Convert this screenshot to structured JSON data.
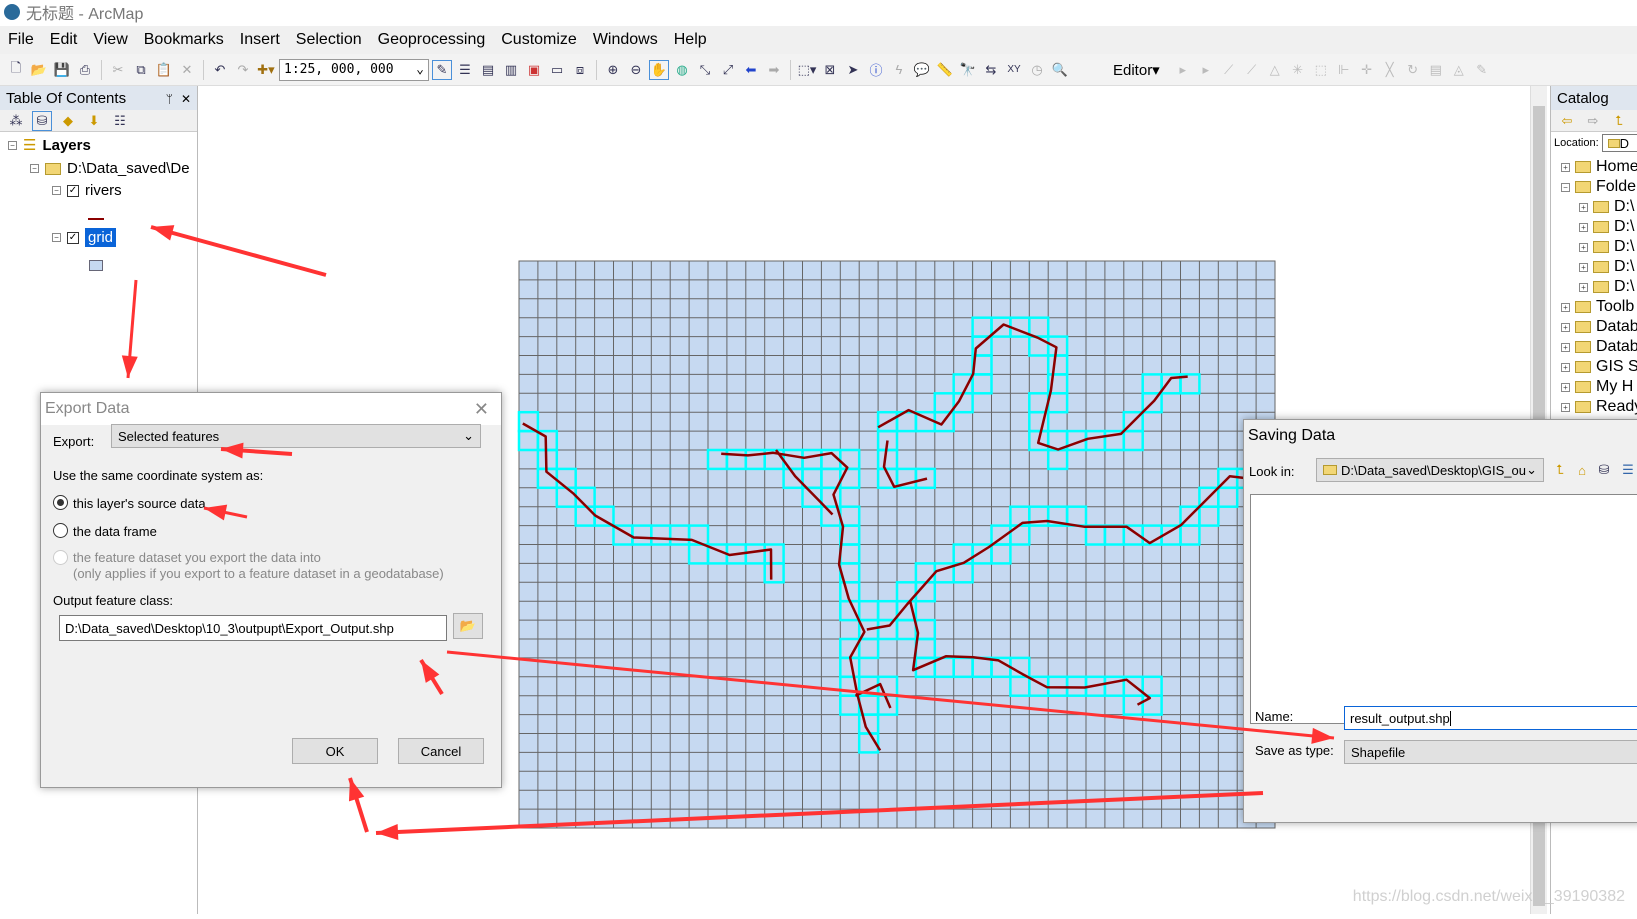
{
  "window": {
    "title": "无标题 - ArcMap"
  },
  "menu": [
    "File",
    "Edit",
    "View",
    "Bookmarks",
    "Insert",
    "Selection",
    "Geoprocessing",
    "Customize",
    "Windows",
    "Help"
  ],
  "toolbar": {
    "scale": "1:25, 000, 000",
    "editor_label": "Editor▾"
  },
  "toc": {
    "title": "Table Of Contents",
    "pin": "ᛘ",
    "close": "✕",
    "root": "Layers",
    "folder": "D:\\Data_saved\\De",
    "layers": [
      {
        "name": "rivers",
        "checked": true
      },
      {
        "name": "grid",
        "checked": true,
        "selected": true
      }
    ]
  },
  "catalog": {
    "title": "Catalog",
    "location_label": "Location:",
    "location_value": "D",
    "items": [
      "Home",
      "Folde",
      "D:\\",
      "D:\\",
      "D:\\",
      "D:\\",
      "D:\\",
      "Toolb",
      "Datab",
      "Datab",
      "GIS Se",
      "My H",
      "Ready"
    ]
  },
  "export_dialog": {
    "title": "Export Data",
    "export_label": "Export:",
    "export_value": "Selected features",
    "coord_label": "Use the same coordinate system as:",
    "options": [
      {
        "label": "this layer's source data",
        "selected": true
      },
      {
        "label": "the data frame",
        "selected": false
      },
      {
        "label": "the feature dataset you export the data into",
        "note": "(only applies if you export to a feature dataset in a geodatabase)",
        "disabled": true
      }
    ],
    "output_label": "Output feature class:",
    "output_value": "D:\\Data_saved\\Desktop\\10_3\\outpupt\\Export_Output.shp",
    "ok": "OK",
    "cancel": "Cancel"
  },
  "saving_dialog": {
    "title": "Saving Data",
    "look_in_label": "Look in:",
    "look_in_value": "D:\\Data_saved\\Desktop\\GIS_ou",
    "name_label": "Name:",
    "name_value": "result_output.shp",
    "type_label": "Save as type:",
    "type_value": "Shapefile"
  },
  "map": {
    "grid_fill": "#c6d9f1",
    "grid_line": "#666666",
    "selection_color": "#00ffff",
    "river_color": "#8b0000",
    "annotation_color": "#ff3333"
  },
  "watermark": "https://blog.csdn.net/weixin_39190382"
}
